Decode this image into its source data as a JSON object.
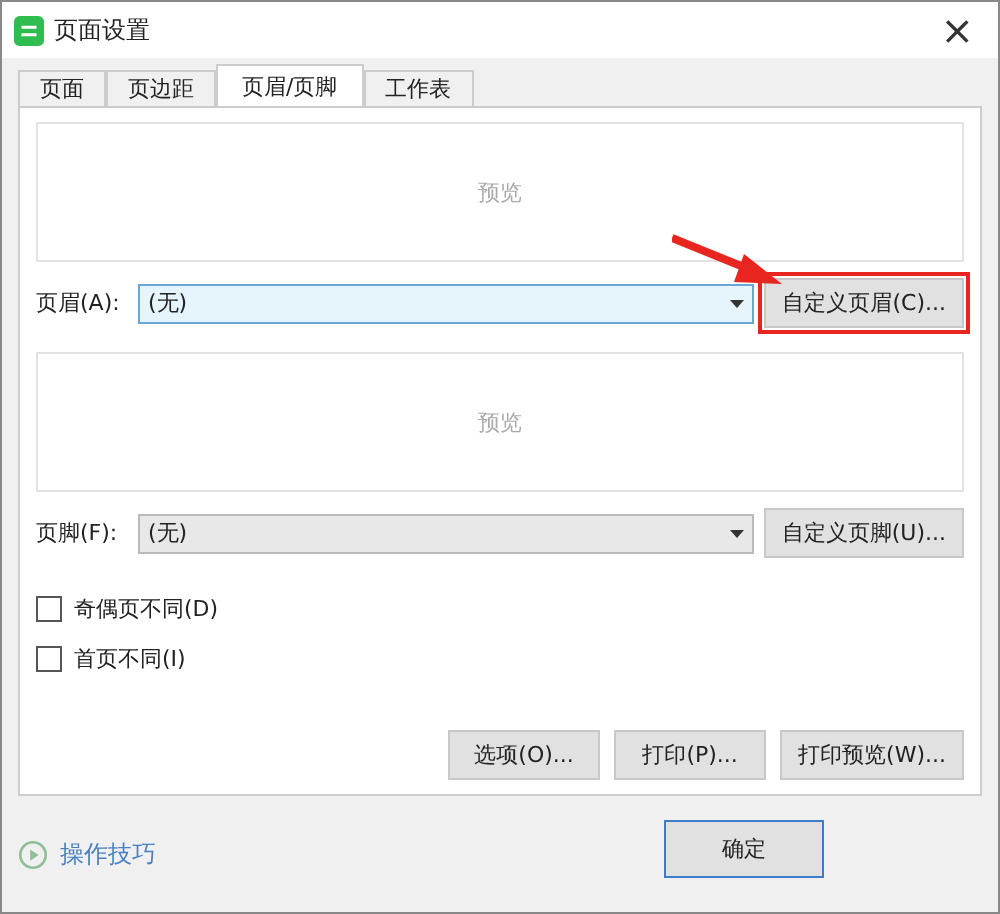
{
  "window": {
    "title": "页面设置",
    "close": "×"
  },
  "tabs": [
    {
      "label": "页面",
      "selected": false
    },
    {
      "label": "页边距",
      "selected": false
    },
    {
      "label": "页眉/页脚",
      "selected": true
    },
    {
      "label": "工作表",
      "selected": false
    }
  ],
  "header": {
    "preview": "预览",
    "label": "页眉(A):",
    "value": "(无)",
    "button": "自定义页眉(C)...",
    "highlighted": true
  },
  "footer": {
    "preview": "预览",
    "label": "页脚(F):",
    "value": "(无)",
    "button": "自定义页脚(U)..."
  },
  "checkboxes": [
    {
      "label": "奇偶页不同(D)",
      "checked": false
    },
    {
      "label": "首页不同(I)",
      "checked": false
    }
  ],
  "buttons": [
    "选项(O)...",
    "打印(P)...",
    "打印预览(W)..."
  ],
  "tips": "操作技巧",
  "ok": "确定"
}
